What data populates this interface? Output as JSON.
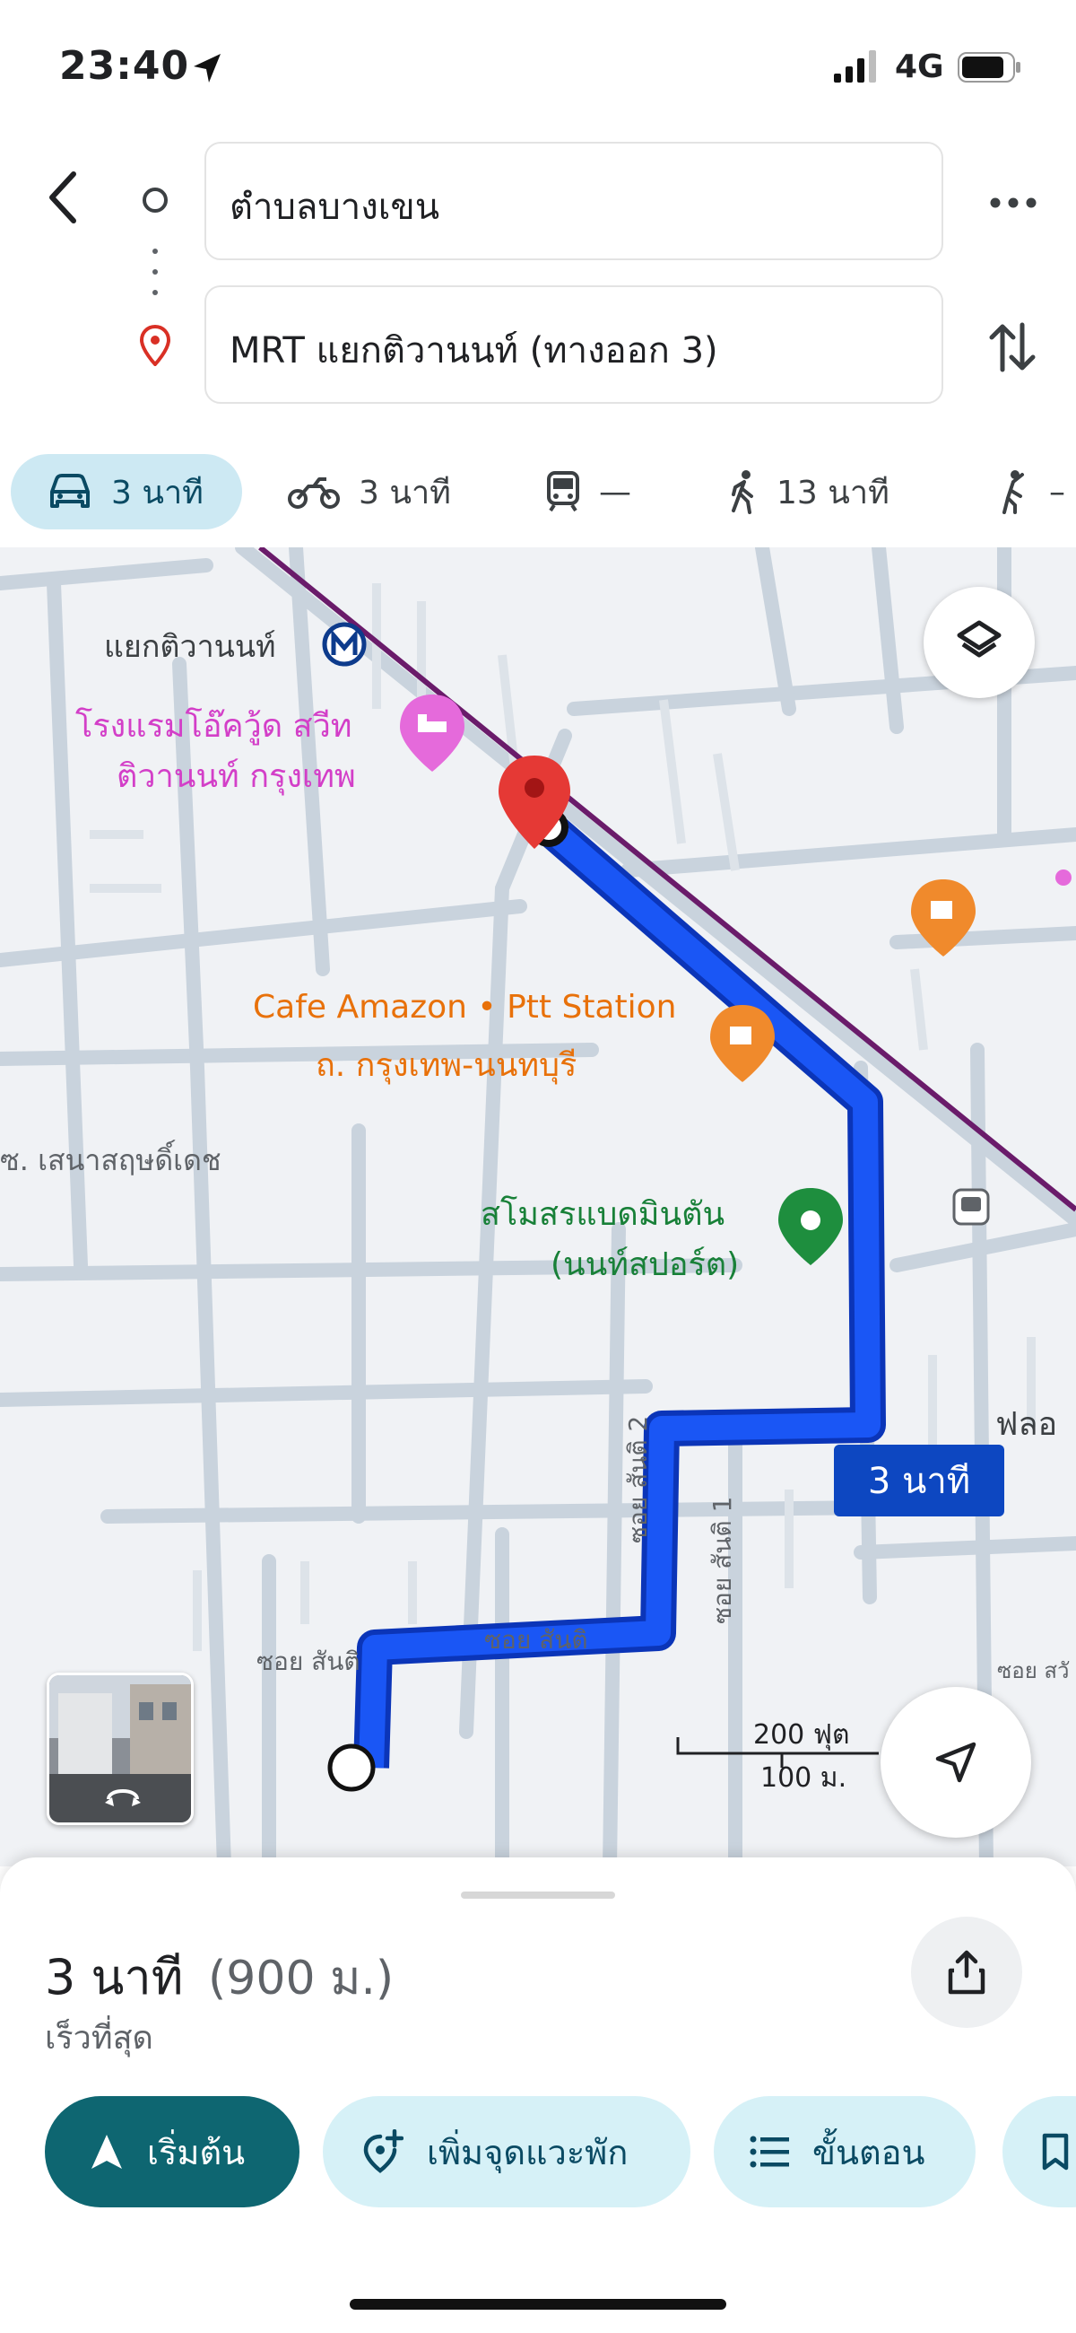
{
  "status_bar": {
    "time": "23:40",
    "network": "4G",
    "icons": [
      "location-arrow-icon",
      "signal-bars-icon",
      "battery-icon"
    ]
  },
  "directions": {
    "origin": "ตำบลบางเขน",
    "destination": "MRT แยกติวานนท์ (ทางออก 3)",
    "icons": [
      "back-arrow-icon",
      "origin-circle-icon",
      "destination-pin-icon",
      "more-dots-icon",
      "swap-icon"
    ]
  },
  "modes": [
    {
      "id": "drive",
      "icon": "car-icon",
      "label": "3 นาที",
      "selected": true
    },
    {
      "id": "motorbike",
      "icon": "motorbike-icon",
      "label": "3 นาที",
      "selected": false
    },
    {
      "id": "transit",
      "icon": "train-icon",
      "label": "—",
      "selected": false
    },
    {
      "id": "walk",
      "icon": "walk-icon",
      "label": "13 นาที",
      "selected": false
    },
    {
      "id": "ride",
      "icon": "ride-hail-icon",
      "label": "–",
      "selected": false
    }
  ],
  "map": {
    "labels": {
      "station": "แยกติวานนท์",
      "hotel_line1": "โรงแรมโอ๊ควู้ด สวีท",
      "hotel_line2": "ติวานนท์ กรุงเทพ",
      "cafe_line1": "Cafe Amazon • Ptt Station",
      "cafe_line2": "ถ. กรุงเทพ-นนทบุรี",
      "soi_west": "ซ. เสนาสฤษดิ์เดช",
      "club_line1": "สโมสรแบดมินตัน",
      "club_line2": "(นนท์สปอร์ต)",
      "right_edge": "ฟลอ",
      "soi_santi_a": "ซอย สันติ",
      "soi_santi_b": "ซอย สันติ",
      "soi_santi_2": "ซอย สันติ 2",
      "soi_santi_1": "ซอย สันติ 1",
      "soi_right": "ซอย สวั"
    },
    "route_time": "3 นาที",
    "scale_ft": "200 ฟุต",
    "scale_m": "100 ม.",
    "colors": {
      "route": "#1a56f5",
      "route_outline": "#0b35b8",
      "rail": "#6a1b6a",
      "road": "#c9d3dd",
      "background": "#f0f2f5"
    },
    "icons": [
      "layers-icon",
      "my-location-icon",
      "street-view-thumbnail",
      "metro-station-icon",
      "hotel-icon",
      "coffee-icon",
      "sports-icon",
      "bus-stop-icon",
      "destination-pin-icon",
      "start-dot-icon"
    ]
  },
  "summary": {
    "duration": "3 นาที",
    "distance": "(900 ม.)",
    "subtitle": "เร็วที่สุด",
    "actions": {
      "start": "เริ่มต้น",
      "add_stop": "เพิ่มจุดแวะพัก",
      "steps": "ขั้นตอน"
    },
    "colors": {
      "start_button": "#0e6671",
      "chip": "#d6f1f7"
    }
  }
}
